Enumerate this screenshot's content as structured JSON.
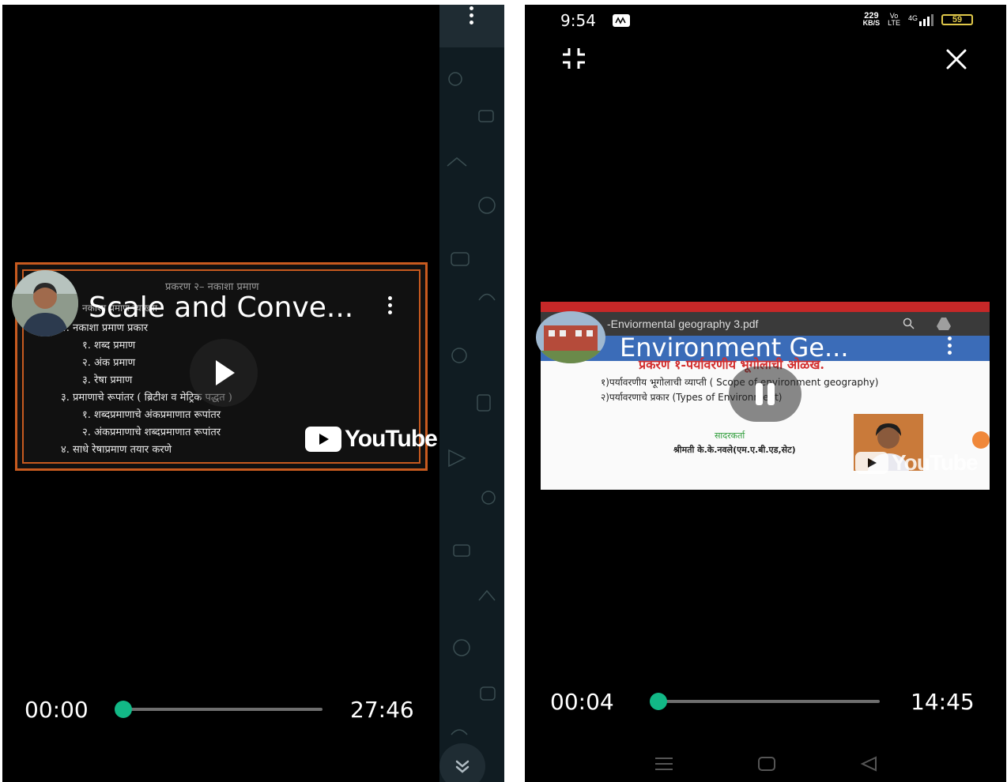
{
  "left_player": {
    "video_title": "Scale and Conve...",
    "slide": {
      "heading": "प्रकरण २– नकाशा प्रमाण",
      "lines": [
        "नकाशा प्रमाण व्याख्या",
        "२.  नकाशा प्रमाण प्रकार",
        "१.  शब्द प्रमाण",
        "२.  अंक प्रमाण",
        "३.  रेषा प्रमाण",
        "३.  प्रमाणाचे रूपांतर ( ब्रिटीश व मेट्रिक पद्धत )",
        "१.  शब्दप्रमाणाचे अंकप्रमाणात रूपांतर",
        "२.  अंकप्रमाणाचे शब्दप्रमाणात रूपांतर",
        "४.  साधे रेषाप्रमाण तयार करणे"
      ]
    },
    "youtube_label": "YouTube",
    "current_time": "00:00",
    "duration": "27:46",
    "progress": 0.0
  },
  "right_player": {
    "status": {
      "time": "9:54",
      "data_rate_top": "229",
      "data_rate_unit": "KB/S",
      "volte_top": "Vo",
      "volte_bottom": "LTE",
      "network": "4G",
      "battery": "59"
    },
    "video_title": "Environment Ge...",
    "pdf_name": "-Enviormental geography 3.pdf",
    "slide": {
      "heading": "प्रकरण १-पर्यावरणीय भूगोलाची ओळख.",
      "line1": "१)पर्यावरणीय भूगोलाची  व्याप्ती ( Scope of environment  geography)",
      "line2": "२)पर्यावरणाचे प्रकार (Types of Environment)",
      "presenter_label": "सादरकर्ता",
      "presenter_name": "श्रीमती के.के.नवले(एम.ए.बी.एड,सेट)"
    },
    "youtube_label": "YouTube",
    "current_time": "00:04",
    "duration": "14:45",
    "progress": 0.005
  },
  "colors": {
    "accent": "#12b886",
    "slide_border": "#c75a1f",
    "slide_heading_red": "#d32f2f",
    "presenter_green": "#2e9d3a"
  },
  "icons": {
    "left": [
      "more-vert-icon",
      "play-icon",
      "chevrons-down-icon",
      "youtube-logo"
    ],
    "right": [
      "exit-fullscreen-icon",
      "close-icon",
      "more-vert-icon",
      "pause-icon",
      "menu-icon",
      "home-icon",
      "back-icon"
    ]
  }
}
